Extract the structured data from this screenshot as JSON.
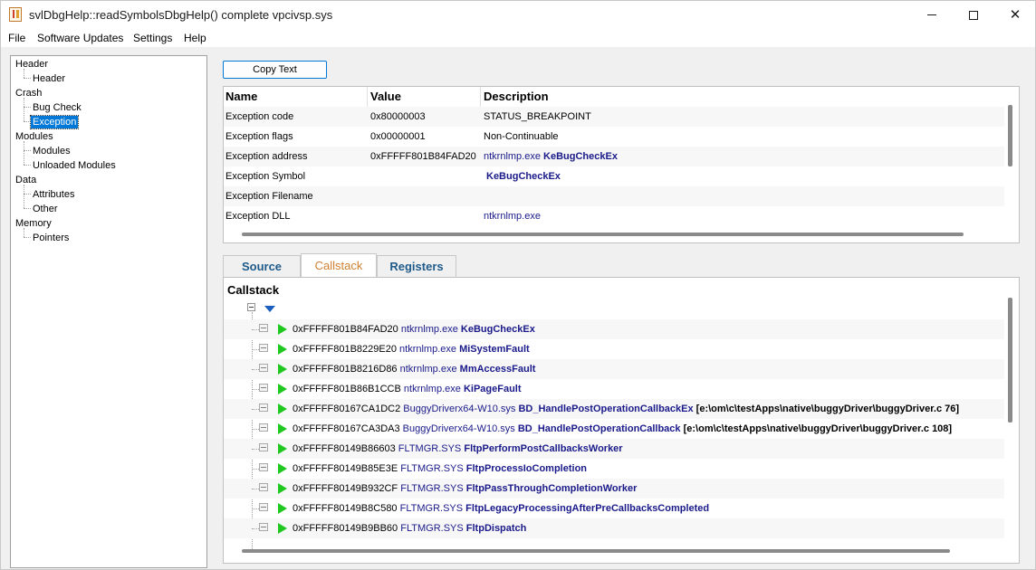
{
  "window": {
    "title": "svlDbgHelp::readSymbolsDbgHelp() complete vpcivsp.sys",
    "controls": {
      "minimize": "minimize-icon",
      "maximize": "maximize-icon",
      "close": "✕"
    }
  },
  "menu": [
    "File",
    "Software Updates",
    "Settings",
    "Help"
  ],
  "tree": {
    "groups": [
      {
        "label": "Header",
        "children": [
          "Header"
        ]
      },
      {
        "label": "Crash",
        "children": [
          "Bug Check",
          "Exception"
        ]
      },
      {
        "label": "Modules",
        "children": [
          "Modules",
          "Unloaded Modules"
        ]
      },
      {
        "label": "Data",
        "children": [
          "Attributes",
          "Other"
        ]
      },
      {
        "label": "Memory",
        "children": [
          "Pointers"
        ]
      }
    ],
    "selected": "Exception",
    "selected_color": "#0078d7"
  },
  "copy_button": {
    "label": "Copy Text"
  },
  "grid": {
    "columns": [
      "Name",
      "Value",
      "Description"
    ],
    "rows": [
      {
        "name": "Exception code",
        "value": "0x80000003",
        "desc": "STATUS_BREAKPOINT",
        "desc_mod": "",
        "desc_fn": ""
      },
      {
        "name": "Exception flags",
        "value": "0x00000001",
        "desc": "Non-Continuable",
        "desc_mod": "",
        "desc_fn": ""
      },
      {
        "name": "Exception address",
        "value": "0xFFFFF801B84FAD20",
        "desc": "",
        "desc_mod": "ntkrnlmp.exe",
        "desc_fn": "KeBugCheckEx"
      },
      {
        "name": "Exception Symbol",
        "value": "",
        "desc": "",
        "desc_mod": "",
        "desc_fn": "KeBugCheckEx"
      },
      {
        "name": "Exception Filename",
        "value": "",
        "desc": "",
        "desc_mod": "",
        "desc_fn": ""
      },
      {
        "name": "Exception DLL",
        "value": "",
        "desc": "",
        "desc_mod": "ntkrnlmp.exe",
        "desc_fn": ""
      }
    ]
  },
  "tabs": [
    {
      "label": "Source",
      "active": false
    },
    {
      "label": "Callstack",
      "active": true
    },
    {
      "label": "Registers",
      "active": false
    }
  ],
  "callstack": {
    "title": "Callstack",
    "frames": [
      {
        "addr": "0xFFFFF801B84FAD20",
        "module": "ntkrnlmp.exe",
        "function": "KeBugCheckEx",
        "source": ""
      },
      {
        "addr": "0xFFFFF801B8229E20",
        "module": "ntkrnlmp.exe",
        "function": "MiSystemFault",
        "source": ""
      },
      {
        "addr": "0xFFFFF801B8216D86",
        "module": "ntkrnlmp.exe",
        "function": "MmAccessFault",
        "source": ""
      },
      {
        "addr": "0xFFFFF801B86B1CCB",
        "module": "ntkrnlmp.exe",
        "function": "KiPageFault",
        "source": ""
      },
      {
        "addr": "0xFFFFF80167CA1DC2",
        "module": "BuggyDriverx64-W10.sys",
        "function": "BD_HandlePostOperationCallbackEx",
        "source": "[e:\\om\\c\\testApps\\native\\buggyDriver\\buggyDriver.c 76]"
      },
      {
        "addr": "0xFFFFF80167CA3DA3",
        "module": "BuggyDriverx64-W10.sys",
        "function": "BD_HandlePostOperationCallback",
        "source": "[e:\\om\\c\\testApps\\native\\buggyDriver\\buggyDriver.c 108]"
      },
      {
        "addr": "0xFFFFF80149B86603",
        "module": "FLTMGR.SYS",
        "function": "FltpPerformPostCallbacksWorker",
        "source": ""
      },
      {
        "addr": "0xFFFFF80149B85E3E",
        "module": "FLTMGR.SYS",
        "function": "FltpProcessIoCompletion",
        "source": ""
      },
      {
        "addr": "0xFFFFF80149B932CF",
        "module": "FLTMGR.SYS",
        "function": "FltpPassThroughCompletionWorker",
        "source": ""
      },
      {
        "addr": "0xFFFFF80149B8C580",
        "module": "FLTMGR.SYS",
        "function": "FltpLegacyProcessingAfterPreCallbacksCompleted",
        "source": ""
      },
      {
        "addr": "0xFFFFF80149B9BB60",
        "module": "FLTMGR.SYS",
        "function": "FltpDispatch",
        "source": ""
      }
    ]
  },
  "colors": {
    "module_text": "#1a1a8a",
    "play_icon": "#1ec81e",
    "active_tab_text": "#d08030",
    "tab_text": "#1e5a8a"
  }
}
